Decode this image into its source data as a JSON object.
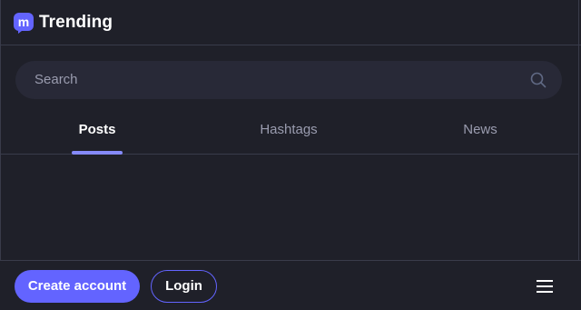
{
  "header": {
    "title": "Trending",
    "logo_icon": "mastodon-logo",
    "logo_letter": "m"
  },
  "search": {
    "placeholder": "Search",
    "icon": "search-icon"
  },
  "tabs": [
    {
      "label": "Posts",
      "active": true
    },
    {
      "label": "Hashtags",
      "active": false
    },
    {
      "label": "News",
      "active": false
    }
  ],
  "footer": {
    "create_account_label": "Create account",
    "login_label": "Login",
    "menu_icon": "hamburger-menu-icon"
  },
  "colors": {
    "background": "#1f2029",
    "accent": "#6364ff",
    "tab_indicator": "#858afa",
    "muted_text": "#9a9caf",
    "search_bg": "#282937",
    "divider": "#393b4a"
  }
}
